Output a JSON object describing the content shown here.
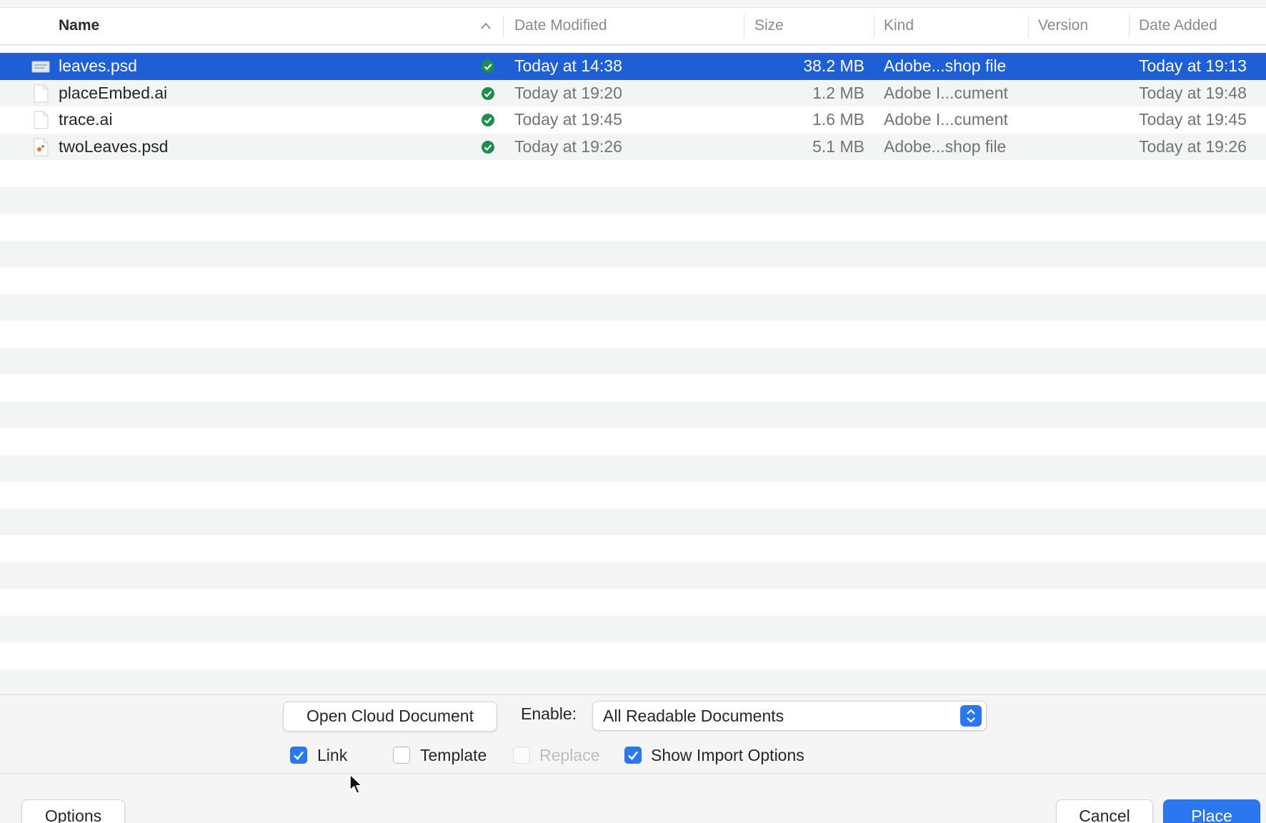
{
  "columns": {
    "name": "Name",
    "date_modified": "Date Modified",
    "size": "Size",
    "kind": "Kind",
    "version": "Version",
    "date_added": "Date Added",
    "sort_indicator_icon": "chevron-up-icon"
  },
  "files": [
    {
      "name": "leaves.psd",
      "date_modified": "Today at 14:38",
      "size": "38.2 MB",
      "kind": "Adobe...shop file",
      "date_added": "Today at 19:13",
      "selected": true,
      "icon": "psd-file-icon",
      "status_icon": "synced-check-icon"
    },
    {
      "name": "placeEmbed.ai",
      "date_modified": "Today at 19:20",
      "size": "1.2 MB",
      "kind": "Adobe I...cument",
      "date_added": "Today at 19:48",
      "selected": false,
      "icon": "ai-file-icon",
      "status_icon": "synced-check-icon"
    },
    {
      "name": "trace.ai",
      "date_modified": "Today at 19:45",
      "size": "1.6 MB",
      "kind": "Adobe I...cument",
      "date_added": "Today at 19:45",
      "selected": false,
      "icon": "ai-file-icon",
      "status_icon": "synced-check-icon"
    },
    {
      "name": "twoLeaves.psd",
      "date_modified": "Today at 19:26",
      "size": "5.1 MB",
      "kind": "Adobe...shop file",
      "date_added": "Today at 19:26",
      "selected": false,
      "icon": "psd-file-icon",
      "status_icon": "synced-check-icon"
    }
  ],
  "controls": {
    "open_cloud_label": "Open Cloud Document",
    "enable_label": "Enable:",
    "enable_value": "All Readable Documents",
    "link_label": "Link",
    "link_checked": true,
    "template_label": "Template",
    "template_checked": false,
    "replace_label": "Replace",
    "replace_enabled": false,
    "show_import_label": "Show Import Options",
    "show_import_checked": true
  },
  "footer": {
    "options_label": "Options",
    "cancel_label": "Cancel",
    "place_label": "Place"
  },
  "colors": {
    "selection": "#1f5fd6",
    "accent": "#2a77f0",
    "status_green": "#1e8e4e",
    "stripe": "#f3f4f4"
  }
}
